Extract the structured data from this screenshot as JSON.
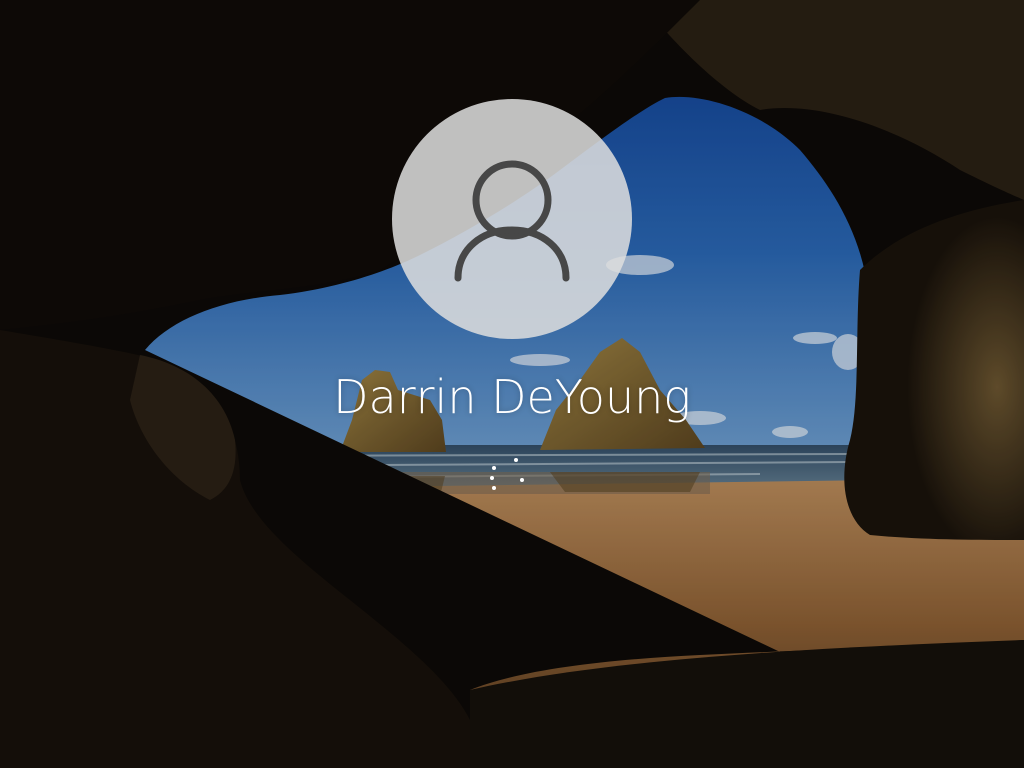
{
  "lock_screen": {
    "user_name": "Darrin DeYoung",
    "avatar_icon": "user-icon",
    "status": "signing-in",
    "loading_icon": "spinner-dots-icon"
  },
  "colors": {
    "avatar_bg": "#dedede",
    "avatar_glyph": "#474747",
    "text": "#ffffff",
    "sky": "#2a64b0",
    "sand": "#9a6a3a",
    "cave_rock": "#120e0a"
  }
}
